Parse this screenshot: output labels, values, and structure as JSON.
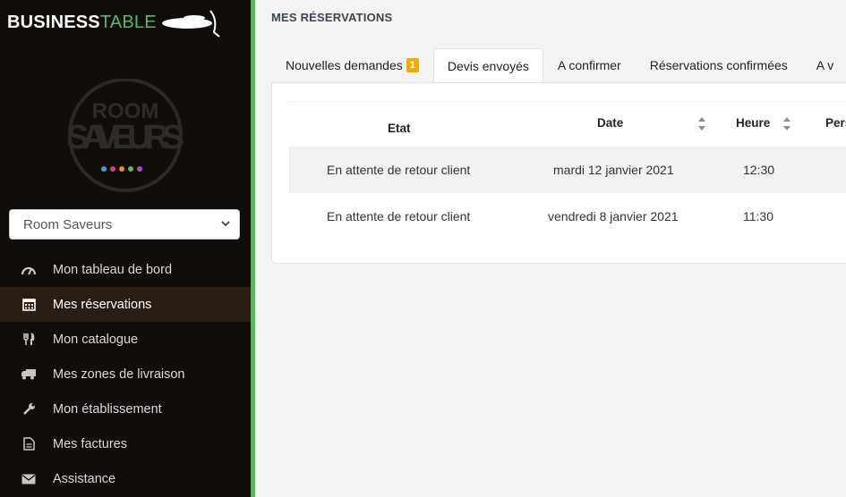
{
  "brand": {
    "bold": "BUSINESS",
    "light": "TABLE"
  },
  "venue_logo": {
    "line1": "ROOM",
    "line2": "SAVEURS",
    "dot_colors": [
      "#3a9bd9",
      "#e23b7a",
      "#f28c28",
      "#5cb85c",
      "#b04bd0"
    ]
  },
  "venue_select": {
    "value": "Room Saveurs"
  },
  "menu": [
    {
      "label": "Mon tableau de bord",
      "icon": "dashboard-icon",
      "active": false
    },
    {
      "label": "Mes réservations",
      "icon": "calendar-icon",
      "active": true
    },
    {
      "label": "Mon catalogue",
      "icon": "cutlery-icon",
      "active": false
    },
    {
      "label": "Mes zones de livraison",
      "icon": "truck-icon",
      "active": false
    },
    {
      "label": "Mon établissement",
      "icon": "wrench-icon",
      "active": false
    },
    {
      "label": "Mes factures",
      "icon": "file-icon",
      "active": false
    },
    {
      "label": "Assistance",
      "icon": "envelope-icon",
      "active": false
    }
  ],
  "page": {
    "title": "MES RÉSERVATIONS"
  },
  "tabs": [
    {
      "label": "Nouvelles demandes",
      "badge": "1",
      "active": false
    },
    {
      "label": "Devis envoyés",
      "active": true
    },
    {
      "label": "A confirmer",
      "active": false
    },
    {
      "label": "Réservations confirmées",
      "active": false
    },
    {
      "label": "A v",
      "active": false
    }
  ],
  "table": {
    "headers": {
      "etat": "Etat",
      "date": "Date",
      "heure": "Heure",
      "pers": "Pers"
    },
    "rows": [
      {
        "etat": "En attente de retour client",
        "date": "mardi 12 janvier 2021",
        "heure": "12:30"
      },
      {
        "etat": "En attente de retour client",
        "date": "vendredi 8 janvier 2021",
        "heure": "11:30"
      }
    ]
  },
  "colors": {
    "sidebar_bg": "#100d0a",
    "accent_green": "#5cb85c",
    "badge": "#f0ad00",
    "active_menu_bg": "#2a1e14"
  }
}
